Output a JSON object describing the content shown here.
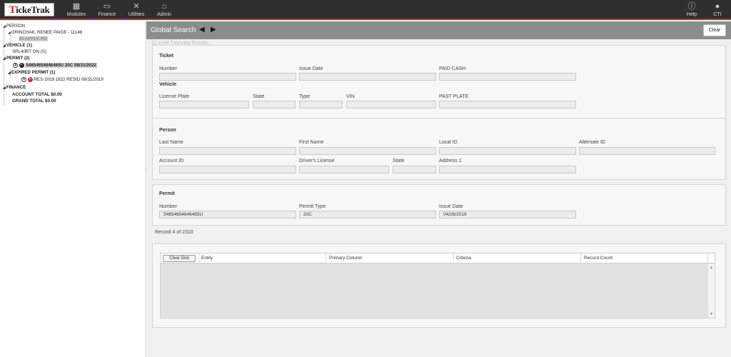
{
  "app": {
    "logo_prefix": "T",
    "logo_rest": "ickeTrak"
  },
  "topnav": {
    "items": [
      {
        "label": "Modules",
        "icon": "grid-icon"
      },
      {
        "label": "Finance",
        "icon": "money-icon"
      },
      {
        "label": "Utilities",
        "icon": "tools-icon"
      },
      {
        "label": "Admin",
        "icon": "building-icon"
      }
    ],
    "right": [
      {
        "label": "Help",
        "icon": "info-icon"
      },
      {
        "label": "CTI",
        "icon": "user-icon"
      }
    ]
  },
  "tree": {
    "person": "PERSON",
    "person_name": "GRINCHAK, RENEE PAIGE - 11148",
    "person_address": "80 APPLE RD",
    "vehicle": "VEHICLE (1)",
    "vehicle_plate": "SRL40RT ON (S)",
    "permit": "PERMIT (2)",
    "permit_item": "54654654646465U 20C 08/31/2022",
    "expired_permit": "EXPIRED PERMIT (1)",
    "expired_item": "RES-2019 1822 RESID 08/31/2019",
    "finance": "FINANCE",
    "account_total": "ACCOUNT TOTAL $0.00",
    "grand_total": "GRAND TOTAL $0.00",
    "dollar_symbol": "$"
  },
  "header": {
    "title": "Global Search",
    "clear_label": "Clear",
    "limit_label": "Limit Treeview Results"
  },
  "ticket": {
    "section_title": "Ticket",
    "number_label": "Number",
    "issue_date_label": "Issue Date",
    "paid_cash_label": "PAID CASH",
    "vehicle_title": "Vehicle",
    "license_plate_label": "License Plate",
    "state_label": "State",
    "type_label": "Type",
    "vin_label": "VIN",
    "past_plate_label": "PAST PLATE"
  },
  "person": {
    "section_title": "Person",
    "last_name_label": "Last Name",
    "first_name_label": "First Name",
    "local_id_label": "Local ID",
    "alternate_id_label": "Alternate ID",
    "account_id_label": "Account ID",
    "drivers_license_label": "Driver's License",
    "state_label": "State",
    "address1_label": "Address 1"
  },
  "permit": {
    "section_title": "Permit",
    "number_label": "Number",
    "number_value": "54654654646465U",
    "permit_type_label": "Permit Type",
    "permit_type_value": "20C",
    "issue_date_label": "Issue Date",
    "issue_date_value": "04/26/2019"
  },
  "record_text": "Record 4 of 2310",
  "grid": {
    "clear_grid_label": "Clear Grid",
    "columns": [
      "Entity",
      "Primary Column",
      "Criteria",
      "Record Count"
    ]
  }
}
